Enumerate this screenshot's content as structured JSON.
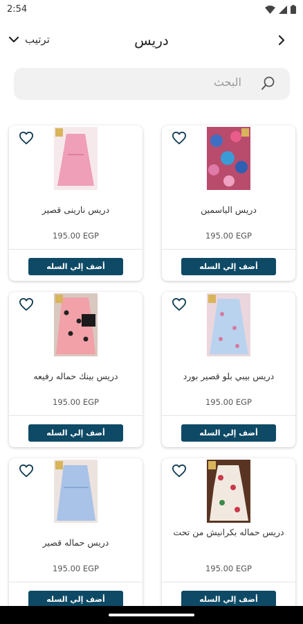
{
  "status": {
    "time": "2:54"
  },
  "header": {
    "title": "دريس",
    "sort_label": "ترتيب"
  },
  "search": {
    "placeholder": "البحث"
  },
  "colors": {
    "button": "#0e4a66",
    "heart": "#0e3a52"
  },
  "products": [
    {
      "name": "دريس الياسمين",
      "price": "195.00 EGP",
      "button": "أضف إلي السله",
      "image": "floral-dress-photo"
    },
    {
      "name": "دريس نارينى قصير",
      "price": "195.00 EGP",
      "button": "أضف إلي السله",
      "image": "pink-dress-photo"
    },
    {
      "name": "دريس بيبي بلو قصير بورد",
      "price": "195.00 EGP",
      "button": "أضف إلي السله",
      "image": "blue-floral-dress-photo"
    },
    {
      "name": "دريس بينك حماله رفيعه",
      "price": "195.00 EGP",
      "button": "أضف إلي السله",
      "image": "pink-dotted-dress-photo"
    },
    {
      "name": "دريس حماله بكرانيش من تحت",
      "price": "195.00 EGP",
      "button": "أضف إلي السله",
      "image": "floral-ruffle-dress-photo"
    },
    {
      "name": "دريس حماله قصير",
      "price": "195.00 EGP",
      "button": "أضف إلي السله",
      "image": "blue-short-dress-photo"
    }
  ]
}
